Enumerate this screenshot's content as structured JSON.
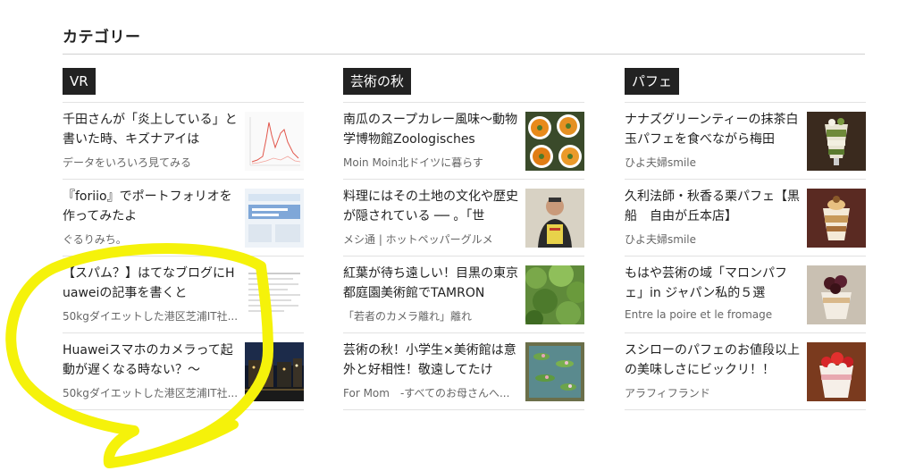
{
  "section": {
    "title": "カテゴリー"
  },
  "columns": [
    {
      "label": "VR",
      "entries": [
        {
          "title": "千田さんが「炎上している」と書いた時、キズナアイは",
          "site": "データをいろいろ見てみる",
          "thumb": "line-chart-thumbnail"
        },
        {
          "title": "『foriio』でポートフォリオを作ってみたよ",
          "site": "ぐるりみち。",
          "thumb": "portfolio-screenshot-thumbnail"
        },
        {
          "title": "【スパム？】はてなブログにHuaweiの記事を書くと",
          "site": "50kgダイエットした港区芝浦IT社...",
          "thumb": "blog-screenshot-thumbnail"
        },
        {
          "title": "Huaweiスマホのカメラって起動が遅くなる時ない？〜",
          "site": "50kgダイエットした港区芝浦IT社...",
          "thumb": "night-city-photo-thumbnail"
        }
      ]
    },
    {
      "label": "芸術の秋",
      "entries": [
        {
          "title": "南瓜のスープカレー風味〜動物学博物館Zoologisches",
          "site": "Moin Moin北ドイツに暮らす",
          "thumb": "soup-bowls-photo-thumbnail"
        },
        {
          "title": "料理にはその土地の文化や歴史が隠されている ── 。「世",
          "site": "メシ通 | ホットペッパーグルメ",
          "thumb": "person-holding-book-thumbnail"
        },
        {
          "title": "紅葉が待ち遠しい！目黒の東京都庭園美術館でTAMRON",
          "site": "「若者のカメラ離れ」離れ",
          "thumb": "garden-foliage-photo-thumbnail"
        },
        {
          "title": "芸術の秋！小学生×美術館は意外と好相性！敬遠してたけ",
          "site": "For Mom　-すべてのお母さんへ...",
          "thumb": "water-lilies-painting-thumbnail"
        }
      ]
    },
    {
      "label": "パフェ",
      "entries": [
        {
          "title": "ナナズグリーンティーの抹茶白玉パフェを食べながら梅田",
          "site": "ひよ夫婦smile",
          "thumb": "matcha-parfait-photo-thumbnail"
        },
        {
          "title": "久利法師・秋香る栗パフェ【黒船　自由が丘本店】",
          "site": "ひよ夫婦smile",
          "thumb": "chestnut-parfait-photo-thumbnail"
        },
        {
          "title": "もはや芸術の域「マロンパフェ」in ジャパン私的５選",
          "site": "Entre la poire et le fromage",
          "thumb": "marron-parfait-photo-thumbnail"
        },
        {
          "title": "スシローのパフェのお値段以上の美味しさにビックリ！！",
          "site": "アラフィフランド",
          "thumb": "strawberry-parfait-photo-thumbnail"
        }
      ]
    }
  ],
  "colors": {
    "label_bg": "#222222",
    "scribble": "#f5f20a"
  }
}
